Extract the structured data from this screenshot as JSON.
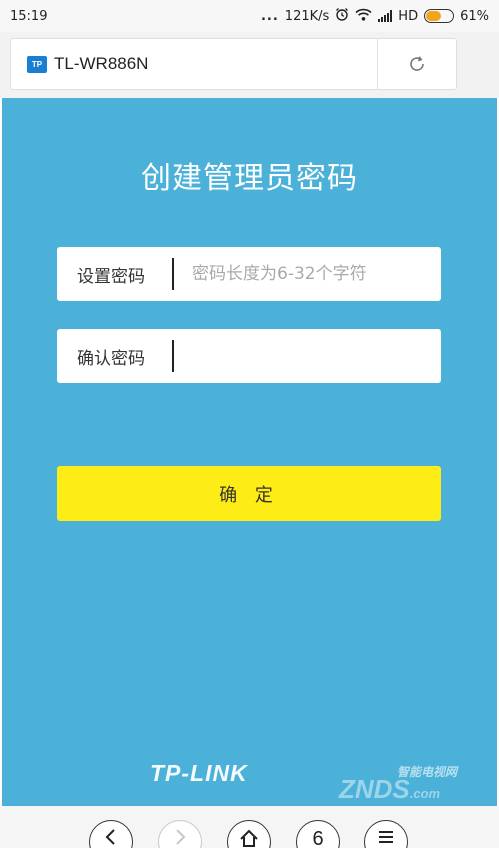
{
  "status_bar": {
    "time": "15:19",
    "dots": "...",
    "network_speed": "121K/s",
    "hd_label": "HD",
    "battery_percent": "61%",
    "battery_level": 0.61,
    "icons": [
      "alarm-icon",
      "wifi-icon",
      "signal-icon",
      "battery-icon"
    ]
  },
  "browser": {
    "site_icon_text": "TP",
    "page_title": "TL-WR886N",
    "reload_icon": "reload-icon"
  },
  "form": {
    "heading": "创建管理员密码",
    "password_label": "设置密码",
    "password_placeholder": "密码长度为6-32个字符",
    "confirm_label": "确认密码",
    "confirm_placeholder": "",
    "submit_label": "确 定"
  },
  "footer": {
    "brand": "TP-LINK",
    "watermark_top": "智能电视网",
    "watermark": "ZNDS",
    "watermark_suffix": ".com"
  },
  "nav": {
    "back_icon": "chevron-left-icon",
    "forward_icon": "chevron-right-icon",
    "home_icon": "home-icon",
    "tab_count": "6",
    "menu_icon": "menu-icon"
  },
  "colors": {
    "page_background": "#4bb1d8",
    "button_background": "#fdec16",
    "battery_fill": "#f7a21b"
  }
}
